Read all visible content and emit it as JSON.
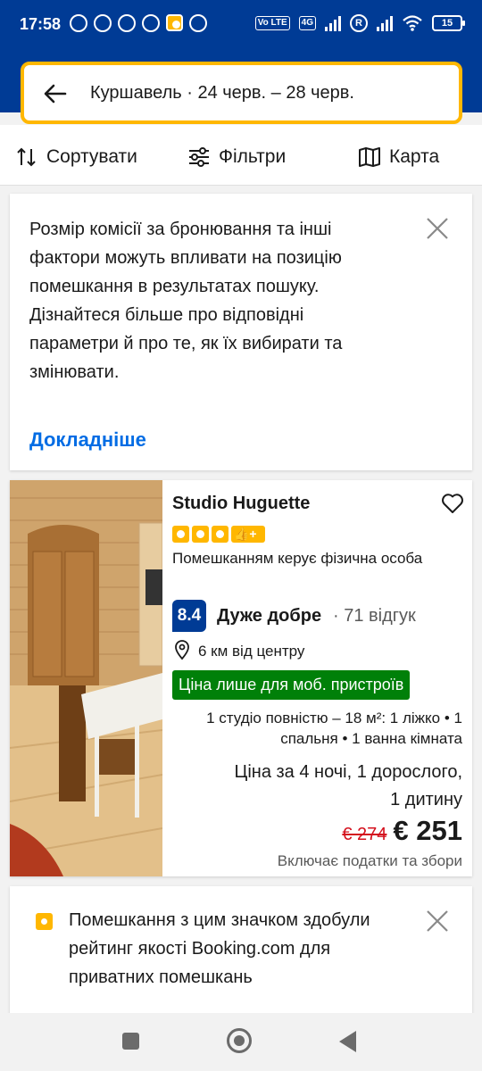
{
  "status_bar": {
    "time": "17:58",
    "network_tag": "4G",
    "volte_tag": "Vo LTE",
    "r_icon": "R",
    "battery": "15"
  },
  "search": {
    "summary": "Куршавель · 24 черв. – 28 черв."
  },
  "toolbar": {
    "sort_label": "Сортувати",
    "filters_label": "Фільтри",
    "map_label": "Карта"
  },
  "notice": {
    "text": "Розмір комісії за бронювання та інші фактори можуть впливати на позицію помешкання в результатах пошуку. Дізнайтеся більше про відповідні параметри й про те, як їх вибирати та змінювати.",
    "link": "Докладніше"
  },
  "hotel": {
    "name": "Studio Huguette",
    "rating_squares": 3,
    "thumb_glyph": "👍+",
    "managed_by": "Помешканням керує фізична особа",
    "score": "8.4",
    "score_word": "Дуже добре",
    "review_count": "· 71 відгук",
    "distance": "6 км від центру",
    "mobile_badge": "Ціна лише для моб. пристроїв",
    "room_description": "1 студіо повністю – 18 м²: 1 ліжко • 1 спальня • 1 ванна кімната",
    "price_for": "Ціна за 4 ночі, 1 дорослого, 1 дитину",
    "old_price": "€ 274",
    "new_price": "€ 251",
    "taxes": "Включає податки та збори"
  },
  "badge_info": {
    "text": "Помешкання з цим значком здобули рейтинг якості Booking.com для приватних помешкань"
  },
  "colors": {
    "brand_blue": "#003b95",
    "accent_yellow": "#ffb700",
    "link_blue": "#006ce4",
    "deal_green": "#008009",
    "price_red": "#d4111e"
  }
}
